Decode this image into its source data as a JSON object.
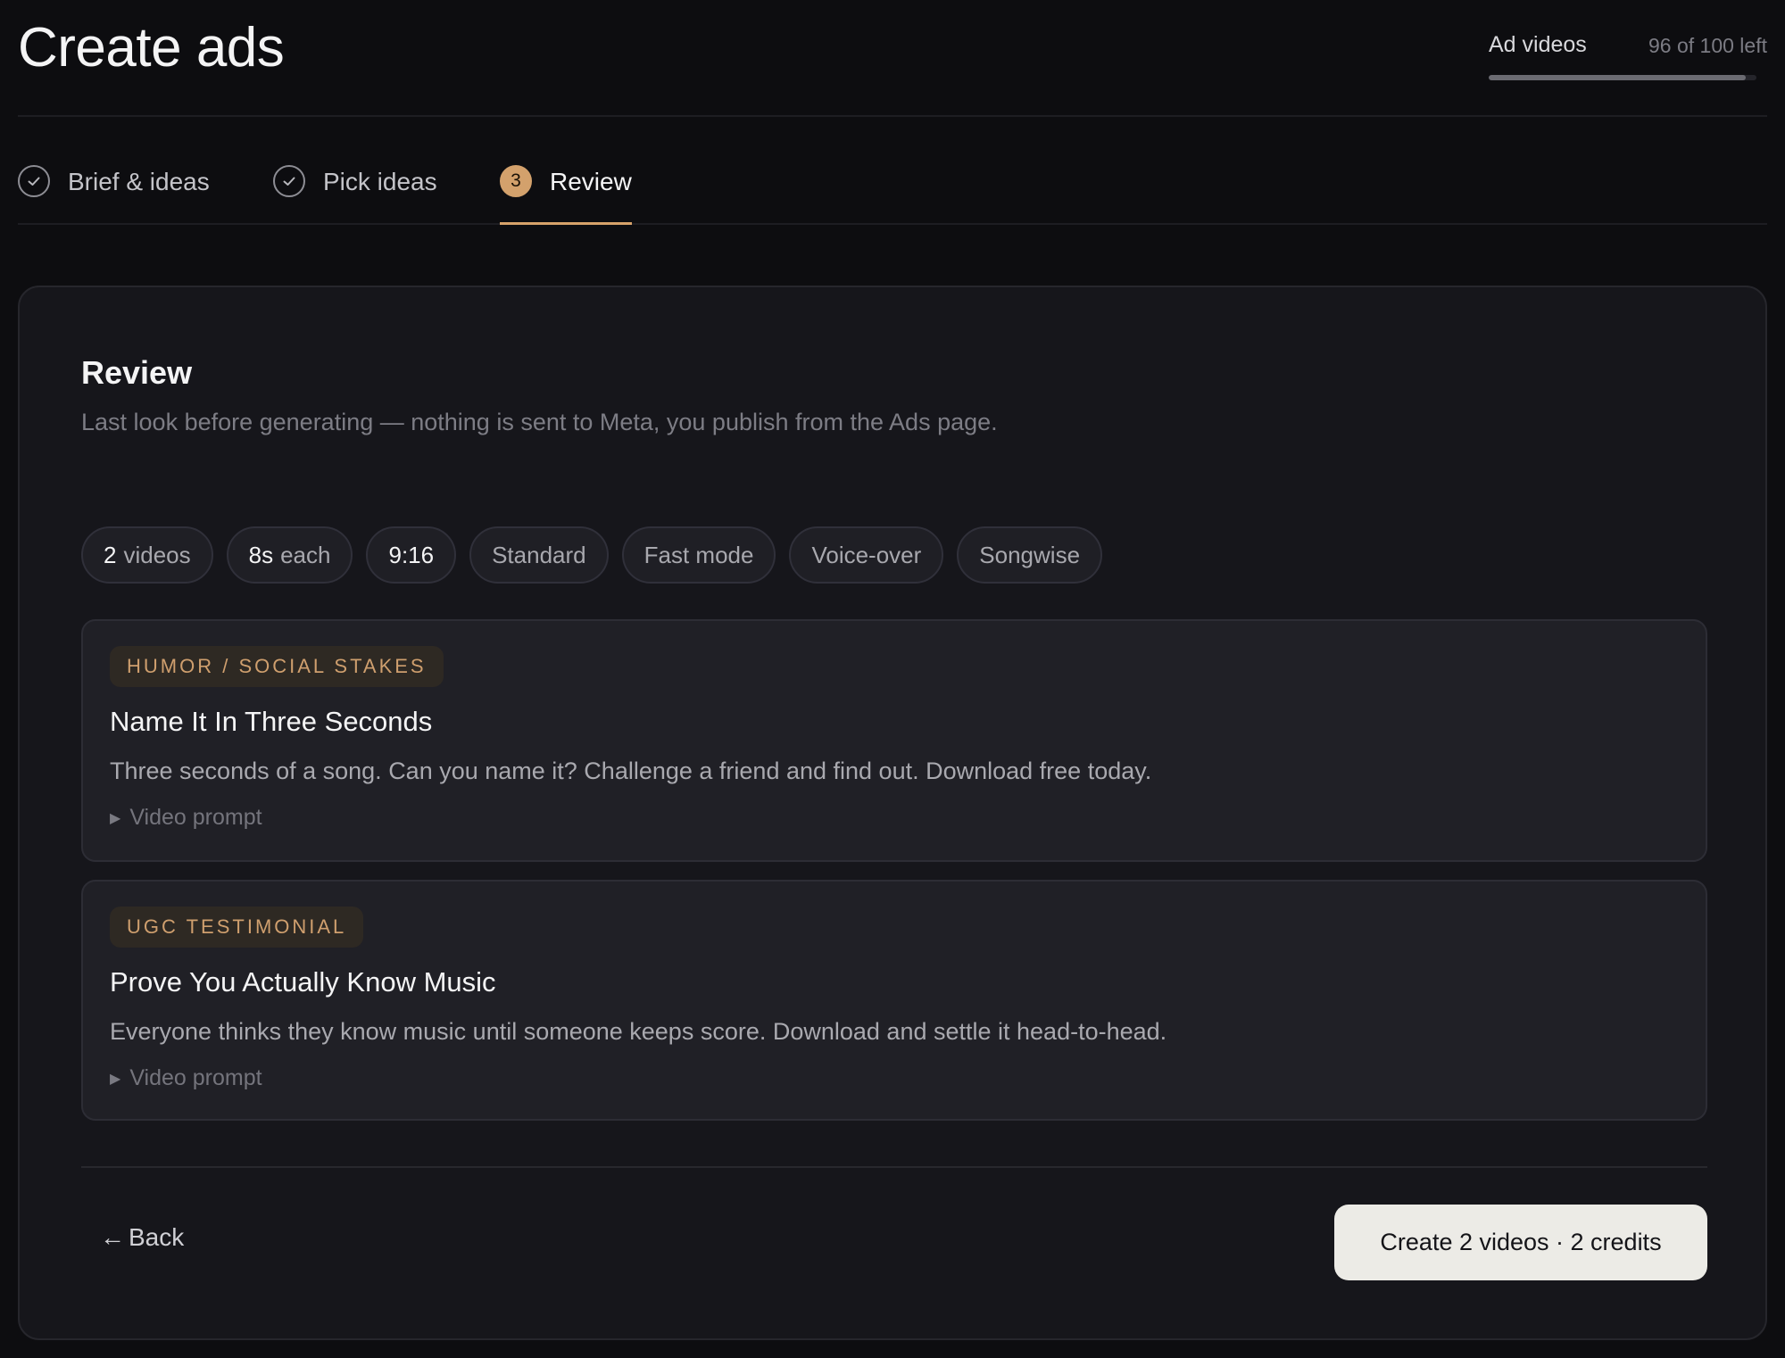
{
  "header": {
    "title": "Create ads",
    "usage": {
      "label": "Ad videos",
      "count_text": "96 of 100 left",
      "used_fraction": 0.96
    }
  },
  "steps": [
    {
      "label": "Brief & ideas",
      "status": "done",
      "icon": "check-icon"
    },
    {
      "label": "Pick ideas",
      "status": "done",
      "icon": "check-icon"
    },
    {
      "label": "Review",
      "status": "active",
      "number": "3"
    }
  ],
  "review": {
    "title": "Review",
    "subtitle": "Last look before generating — nothing is sent to Meta, you publish from the Ads page.",
    "chips": [
      {
        "num": "2",
        "text": "videos"
      },
      {
        "num": "8s",
        "text": "each"
      },
      {
        "num": "9:16",
        "text": ""
      },
      {
        "num": "",
        "text": "Standard"
      },
      {
        "num": "",
        "text": "Fast mode"
      },
      {
        "num": "",
        "text": "Voice-over"
      },
      {
        "num": "",
        "text": "Songwise"
      }
    ],
    "ideas": [
      {
        "tag": "HUMOR / SOCIAL STAKES",
        "title": "Name It In Three Seconds",
        "body": "Three seconds of a song. Can you name it? Challenge a friend and find out. Download free today.",
        "prompt_label": "Video prompt"
      },
      {
        "tag": "UGC TESTIMONIAL",
        "title": "Prove You Actually Know Music",
        "body": "Everyone thinks they know music until someone keeps score. Download and settle it head-to-head.",
        "prompt_label": "Video prompt"
      }
    ]
  },
  "footer": {
    "back_arrow": "←",
    "back_label": "Back",
    "create_label": "Create 2 videos · 2 credits"
  },
  "colors": {
    "accent": "#d3a16c",
    "background": "#0d0d10",
    "panel": "#16161b",
    "primary_button": "#ecebe6"
  }
}
